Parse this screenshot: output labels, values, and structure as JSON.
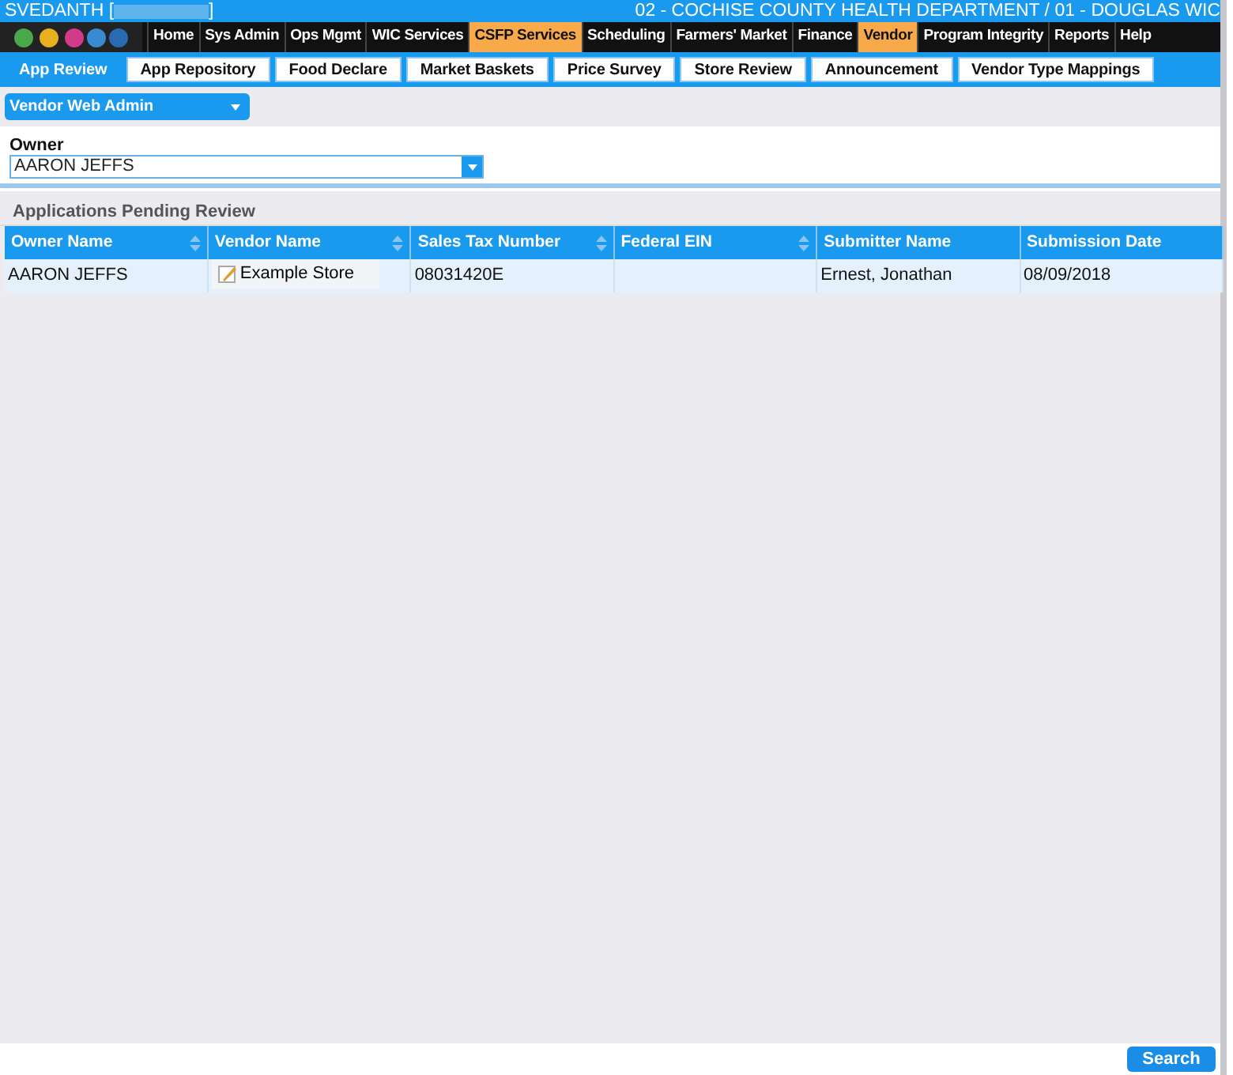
{
  "header": {
    "user": "SVEDANTH [",
    "user_end": "]",
    "agency": "02 - COCHISE COUNTY HEALTH DEPARTMENT / 01 - DOUGLAS WIC"
  },
  "main_menu": [
    {
      "label": "Home",
      "selected": false
    },
    {
      "label": "Sys Admin",
      "selected": false
    },
    {
      "label": "Ops Mgmt",
      "selected": false
    },
    {
      "label": "WIC Services",
      "selected": false
    },
    {
      "label": "CSFP Services",
      "selected": true
    },
    {
      "label": "Scheduling",
      "selected": false
    },
    {
      "label": "Farmers' Market",
      "selected": false
    },
    {
      "label": "Finance",
      "selected": false
    },
    {
      "label": "Vendor",
      "selected": true
    },
    {
      "label": "Program Integrity",
      "selected": false
    },
    {
      "label": "Reports",
      "selected": false
    },
    {
      "label": "Help",
      "selected": false
    }
  ],
  "tabs": [
    {
      "label": "App Review",
      "selected": true
    },
    {
      "label": "App Repository",
      "selected": false
    },
    {
      "label": "Food Declare",
      "selected": false
    },
    {
      "label": "Market Baskets",
      "selected": false
    },
    {
      "label": "Price Survey",
      "selected": false
    },
    {
      "label": "Store Review",
      "selected": false
    },
    {
      "label": "Announcement",
      "selected": false
    },
    {
      "label": "Vendor Type Mappings",
      "selected": false
    }
  ],
  "section_menu": {
    "label": "Vendor Web Admin"
  },
  "owner": {
    "label": "Owner",
    "value": "AARON JEFFS"
  },
  "panel": {
    "title": "Applications Pending Review"
  },
  "table": {
    "columns": [
      {
        "label": "Owner Name",
        "sortable": true
      },
      {
        "label": "Vendor Name",
        "sortable": true
      },
      {
        "label": "Sales Tax Number",
        "sortable": true
      },
      {
        "label": "Federal EIN",
        "sortable": true
      },
      {
        "label": "Submitter Name",
        "sortable": false
      },
      {
        "label": "Submission Date",
        "sortable": false
      }
    ],
    "rows": [
      [
        "AARON JEFFS",
        "Example Store",
        "08031420E",
        "",
        "Ernest, Jonathan",
        "08/09/2018"
      ]
    ]
  },
  "buttons": {
    "search": "Search"
  }
}
